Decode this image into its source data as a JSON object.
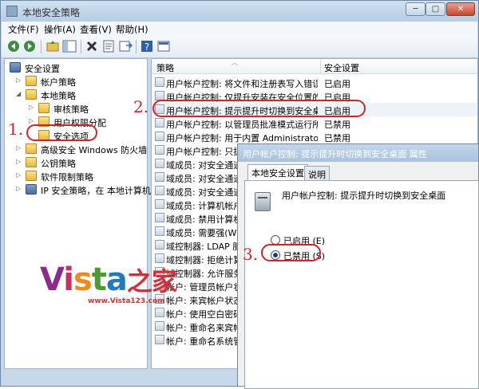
{
  "window": {
    "title": "本地安全策略",
    "buttons": {
      "minimize": "─",
      "maximize": "□",
      "close": "✕"
    }
  },
  "menu": [
    "文件(F)",
    "操作(A)",
    "查看(V)",
    "帮助(H)"
  ],
  "tree": {
    "root": "安全设置",
    "items": [
      {
        "label": "帐户策略",
        "level": 1,
        "expanded": false
      },
      {
        "label": "本地策略",
        "level": 1,
        "expanded": true
      },
      {
        "label": "审核策略",
        "level": 2,
        "expanded": false
      },
      {
        "label": "用户权限分配",
        "level": 2,
        "expanded": false
      },
      {
        "label": "安全选项",
        "level": 2,
        "expanded": false,
        "selected": true
      },
      {
        "label": "高级安全 Windows 防火墙",
        "level": 1,
        "expanded": false
      },
      {
        "label": "公钥策略",
        "level": 1,
        "expanded": false
      },
      {
        "label": "软件限制策略",
        "level": 1,
        "expanded": false
      },
      {
        "label": "IP 安全策略，在 本地计算机",
        "level": 1,
        "expanded": false
      }
    ]
  },
  "list": {
    "headers": {
      "policy": "策略",
      "setting": "安全设置"
    },
    "rows": [
      {
        "policy": "用户帐户控制: 将文件和注册表写入错误...",
        "setting": "已启用"
      },
      {
        "policy": "用户帐户控制: 仅提升安装在安全位置的...",
        "setting": "已启用"
      },
      {
        "policy": "用户帐户控制: 提示提升时切换到安全桌面",
        "setting": "已启用",
        "highlight": true
      },
      {
        "policy": "用户帐户控制: 以管理员批准模式运行所...",
        "setting": "已禁用"
      },
      {
        "policy": "用户帐户控制: 用于内置 Administrator ...",
        "setting": "已禁用"
      },
      {
        "policy": "用户帐户控制: 只提",
        "setting": ""
      },
      {
        "policy": "域成员: 对安全通道",
        "setting": ""
      },
      {
        "policy": "域成员: 对安全通道",
        "setting": ""
      },
      {
        "policy": "域成员: 对安全通道",
        "setting": ""
      },
      {
        "policy": "域成员: 计算机帐户",
        "setting": ""
      },
      {
        "policy": "域成员: 禁用计算机",
        "setting": ""
      },
      {
        "policy": "域成员: 需要强(Win",
        "setting": ""
      },
      {
        "policy": "域控制器: LDAP 服",
        "setting": ""
      },
      {
        "policy": "域控制器: 拒绝计算",
        "setting": ""
      },
      {
        "policy": "域控制器: 允许服务",
        "setting": ""
      },
      {
        "policy": "帐户: 管理员帐户状",
        "setting": ""
      },
      {
        "policy": "帐户: 来宾帐户状态",
        "setting": ""
      },
      {
        "policy": "帐户: 使用空白密码",
        "setting": ""
      },
      {
        "policy": "帐户: 重命名来宾帐",
        "setting": ""
      },
      {
        "policy": "帐户: 重命名系统管",
        "setting": ""
      }
    ]
  },
  "dialog": {
    "title": "用户帐户控制: 提示提升时切换到安全桌面 属性",
    "tabs": [
      "本地安全设置",
      "说明"
    ],
    "policy_name": "用户帐户控制: 提示提升时切换到安全桌面",
    "options": [
      {
        "label": "已启用 (E)",
        "checked": false
      },
      {
        "label": "已禁用 (S)",
        "checked": true
      }
    ]
  },
  "annotations": [
    "1.",
    "2.",
    "3."
  ],
  "watermark": {
    "brand_latin": "Vista",
    "brand_cn": "之家",
    "url": "www.Vista123.com"
  },
  "colors": {
    "annotation": "#d1242a",
    "title_bar": "#b6cde4",
    "selection": "#eef3f9"
  }
}
